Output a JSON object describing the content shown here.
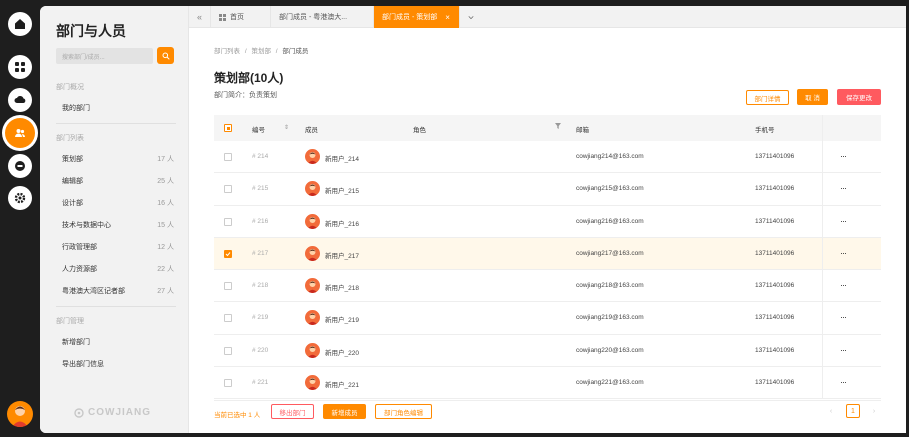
{
  "sidebar": {
    "title": "部门与人员",
    "search_placeholder": "搜索部门/成员...",
    "section_overview": "部门概况",
    "my_dept": "我的部门",
    "section_list": "部门列表",
    "departments": [
      {
        "name": "策划部",
        "count": "17 人"
      },
      {
        "name": "编辑部",
        "count": "25 人"
      },
      {
        "name": "设计部",
        "count": "16 人"
      },
      {
        "name": "技术与数据中心",
        "count": "15 人"
      },
      {
        "name": "行政管理部",
        "count": "12 人"
      },
      {
        "name": "人力资源部",
        "count": "22 人"
      },
      {
        "name": "粤港澳大湾区记者部",
        "count": "27 人"
      }
    ],
    "section_manage": "部门管理",
    "manage_items": [
      "新增部门",
      "导出部门信息"
    ],
    "logo_text": "COWJIANG"
  },
  "tabs": [
    {
      "label": "首页"
    },
    {
      "label": "部门成员 - 粤港澳大..."
    },
    {
      "label": "部门成员 - 策划部"
    }
  ],
  "breadcrumb": {
    "a": "部门列表",
    "b": "策划部",
    "c": "部门成员",
    "sep": "/"
  },
  "page": {
    "title": "策划部(10人)",
    "desc": "部门简介：负责策划"
  },
  "actions": {
    "detail": "部门详情",
    "cancel": "取 消",
    "save": "保存更改"
  },
  "table": {
    "headers": {
      "id": "编号",
      "member": "成员",
      "role": "角色",
      "email": "邮箱",
      "phone": "手机号"
    },
    "rows": [
      {
        "id": "# 214",
        "name": "新用户_214",
        "email": "cowjiang214@163.com",
        "phone": "13711401096",
        "selected": false
      },
      {
        "id": "# 215",
        "name": "新用户_215",
        "email": "cowjiang215@163.com",
        "phone": "13711401096",
        "selected": false
      },
      {
        "id": "# 216",
        "name": "新用户_216",
        "email": "cowjiang216@163.com",
        "phone": "13711401096",
        "selected": false
      },
      {
        "id": "# 217",
        "name": "新用户_217",
        "email": "cowjiang217@163.com",
        "phone": "13711401096",
        "selected": true
      },
      {
        "id": "# 218",
        "name": "新用户_218",
        "email": "cowjiang218@163.com",
        "phone": "13711401096",
        "selected": false
      },
      {
        "id": "# 219",
        "name": "新用户_219",
        "email": "cowjiang219@163.com",
        "phone": "13711401096",
        "selected": false
      },
      {
        "id": "# 220",
        "name": "新用户_220",
        "email": "cowjiang220@163.com",
        "phone": "13711401096",
        "selected": false
      },
      {
        "id": "# 221",
        "name": "新用户_221",
        "email": "cowjiang221@163.com",
        "phone": "13711401096",
        "selected": false
      }
    ],
    "more_icon": "···"
  },
  "footer": {
    "info": "当前已选中 1 人",
    "remove": "移出部门",
    "add": "新增成员",
    "edit_roles": "部门角色编辑",
    "page": "1",
    "prev": "‹",
    "next": "›"
  },
  "colors": {
    "accent": "#ff8a00",
    "danger": "#ff5a5f"
  }
}
